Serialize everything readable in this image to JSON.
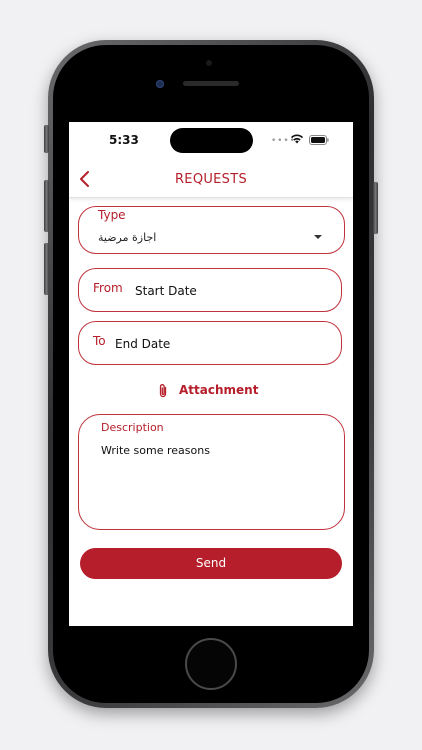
{
  "status_bar": {
    "time": "5:33",
    "signal_icon": "signal-dots",
    "wifi_icon": "wifi-icon",
    "battery_icon": "battery-icon"
  },
  "header": {
    "title": "REQUESTS",
    "back_icon": "chevron-left-icon"
  },
  "form": {
    "type": {
      "label": "Type",
      "value": "اجازة مرضية",
      "icon": "dropdown-arrow-icon"
    },
    "from": {
      "label": "From",
      "value": "Start Date"
    },
    "to": {
      "label": "To",
      "value": "End Date"
    },
    "attachment": {
      "label": "Attachment",
      "icon": "paperclip-icon"
    },
    "description": {
      "label": "Description",
      "placeholder": "Write some reasons"
    },
    "send_label": "Send"
  },
  "colors": {
    "accent": "#b51e2a",
    "border": "#c0323c",
    "background": "#ffffff"
  }
}
